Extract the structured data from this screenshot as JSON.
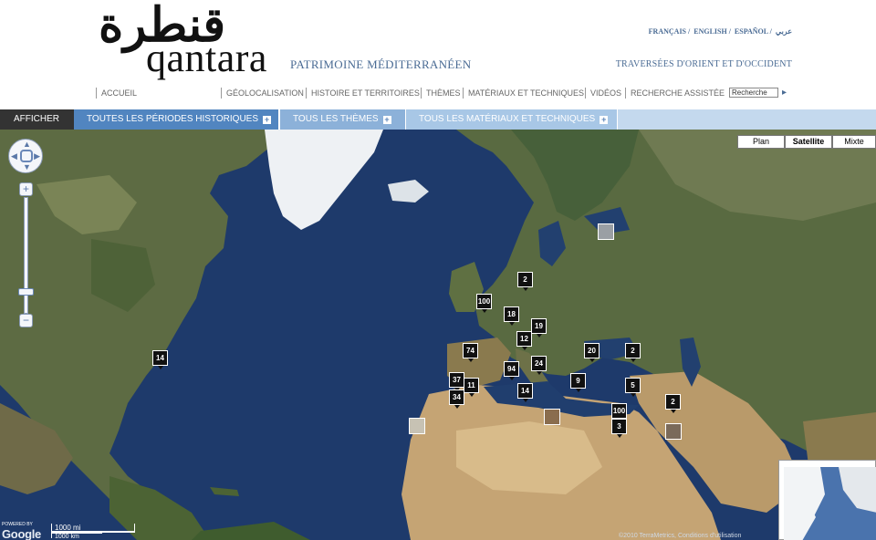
{
  "header": {
    "logo_arabic": "قنطرة",
    "logo_latin": "qantara",
    "tagline": "PATRIMOINE MÉDITERRANÉEN",
    "subtitle": "TRAVERSÉES D'ORIENT ET D'OCCIDENT",
    "languages": [
      "FRANÇAIS /",
      "ENGLISH /",
      "ESPAÑOL /",
      "عربي"
    ]
  },
  "nav": {
    "items": [
      "ACCUEIL",
      "GÉOLOCALISATION",
      "HISTOIRE ET TERRITOIRES",
      "THÈMES",
      "MATÉRIAUX ET TECHNIQUES",
      "VIDÉOS",
      "RECHERCHE ASSISTÉE"
    ],
    "search_value": "Recherche",
    "search_go": "▸"
  },
  "filters": {
    "show_label": "AFFICHER",
    "periods": "TOUTES LES PÉRIODES HISTORIQUES",
    "themes": "TOUS LES THÈMES",
    "materials": "TOUS LES MATÉRIAUX ET TECHNIQUES",
    "plus": "+"
  },
  "map": {
    "type_buttons": [
      "Plan",
      "Satellite",
      "Mixte"
    ],
    "selected_type": "Satellite",
    "zoom_plus": "+",
    "zoom_minus": "−",
    "scale_mi": "1000 mi",
    "scale_km": "1000 km",
    "powered_by": "POWERED BY",
    "google": "Google",
    "copyright": "©2010 TerraMetrics, Conditions d'utilisation",
    "markers": [
      "14",
      "2",
      "100",
      "18",
      "19",
      "12",
      "74",
      "20",
      "2",
      "37",
      "11",
      "34",
      "94",
      "24",
      "14",
      "9",
      "5",
      "100",
      "3",
      "2"
    ],
    "colors": {
      "ocean": "#1e3a6b",
      "land": "#5a6b3c",
      "desert": "#c9a978",
      "ice": "#f2f4f6"
    }
  }
}
